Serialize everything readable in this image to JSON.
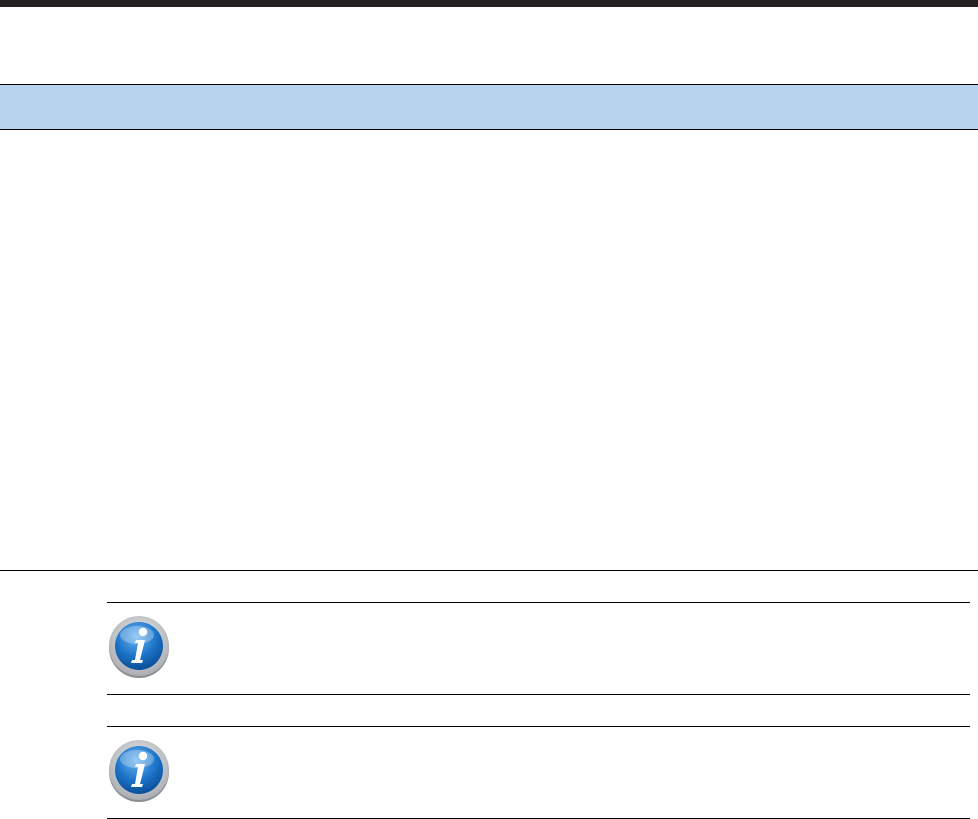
{
  "colors": {
    "top_bar": "#231f20",
    "table_header_fill": "#b7d3ee",
    "info_icon_blue": "#1b73c8",
    "info_icon_ring": "#c9ccd0"
  },
  "icons": {
    "note_1": "info-icon",
    "note_2": "info-icon"
  }
}
